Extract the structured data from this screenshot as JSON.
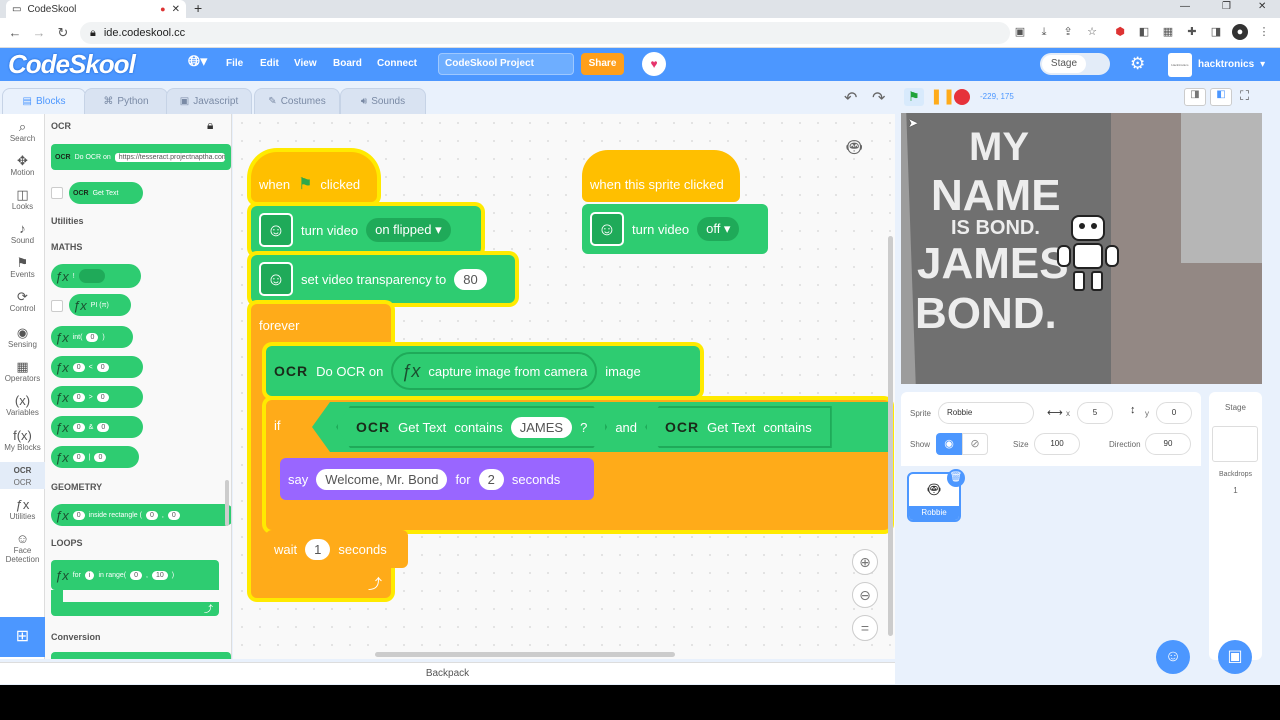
{
  "browser": {
    "tab_title": "CodeSkool",
    "url": "ide.codeskool.cc"
  },
  "menubar": {
    "logo": "CodeSkool",
    "items": [
      "File",
      "Edit",
      "View",
      "Board",
      "Connect"
    ],
    "project_name": "CodeSkool Project",
    "share_label": "Share",
    "stage_toggle": "Stage",
    "username": "hacktronics",
    "avatar_caption": "Hacktronics"
  },
  "tabs": [
    "Blocks",
    "Python",
    "Javascript",
    "Costumes",
    "Sounds"
  ],
  "categories": [
    "Search",
    "Motion",
    "Looks",
    "Sound",
    "Events",
    "Control",
    "Sensing",
    "Operators",
    "Variables",
    "My Blocks",
    "OCR",
    "Utilities",
    "Face Detection"
  ],
  "palette": {
    "ocr_heading": "OCR",
    "ocr_do_label": "Do OCR on",
    "ocr_url": "https://tesseract.projectnaptha.com",
    "ocr_get_text": "Get Text",
    "utilities_heading": "Utilities",
    "maths_heading": "MATHS",
    "maths_not": "!",
    "maths_pi": "PI (π)",
    "maths_int": "int(",
    "zero": "0",
    "op_lt": "<",
    "op_gt": ">",
    "op_and": "&",
    "op_or": "|",
    "close_paren": ")",
    "geometry_heading": "GEOMETRY",
    "geometry_inside": "inside rectangle (",
    "loops_heading": "LOOPS",
    "loop_for": "for",
    "loop_var": "i",
    "loop_in_range": "in range(",
    "loop_end": "10",
    "loop_comma": ",",
    "conversion_heading": "Conversion"
  },
  "script1": {
    "hat_when": "when",
    "hat_clicked": "clicked",
    "turn_video": "turn video",
    "turn_video_value": "on flipped",
    "set_transparency": "set video transparency to",
    "transparency_value": "80",
    "forever": "forever",
    "do_ocr": "Do OCR on",
    "capture_image": "capture image from camera",
    "image": "image",
    "if": "if",
    "get_text": "Get Text",
    "contains": "contains",
    "james": "JAMES",
    "qmark": "?",
    "and": "and",
    "say": "say",
    "say_text": "Welcome, Mr. Bond",
    "say_for": "for",
    "say_secs": "2",
    "seconds": "seconds",
    "wait": "wait",
    "wait_secs": "1"
  },
  "script2": {
    "hat": "when this sprite clicked",
    "turn_video": "turn video",
    "value": "off"
  },
  "backpack": "Backpack",
  "stage": {
    "coords": "-229, 175",
    "line1": "MY",
    "line2": "NAME",
    "line3": "IS BOND.",
    "line4": "JAMES",
    "line5": "BOND."
  },
  "sprite_panel": {
    "sprite_label": "Sprite",
    "sprite_name": "Robbie",
    "x_label": "x",
    "x_value": "5",
    "y_label": "y",
    "y_value": "0",
    "show_label": "Show",
    "size_label": "Size",
    "size_value": "100",
    "direction_label": "Direction",
    "direction_value": "90",
    "thumb_name": "Robbie"
  },
  "stage_panel": {
    "title": "Stage",
    "backdrops_label": "Backdrops",
    "backdrops_count": "1"
  },
  "colors": {
    "primary": "#4c97ff",
    "events": "#ffbf00",
    "control": "#ffab19",
    "extension": "#2ecc71",
    "looks": "#9966ff",
    "glow": "#ffea00"
  }
}
